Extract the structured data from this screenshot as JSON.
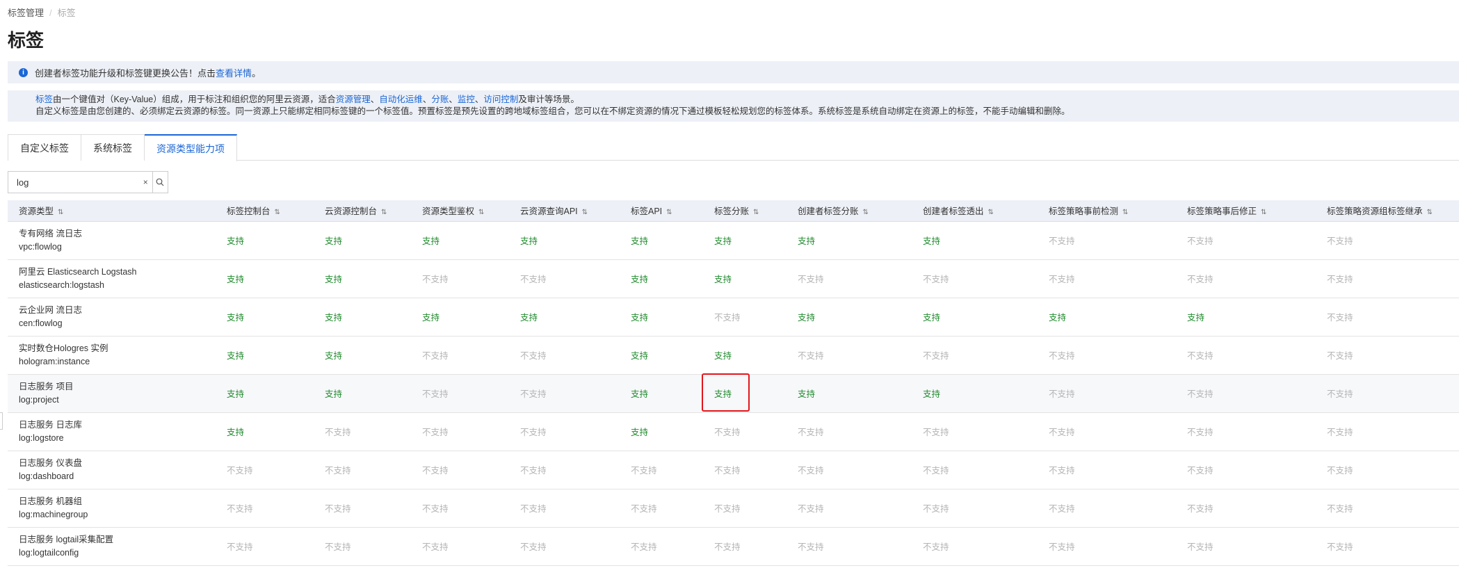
{
  "breadcrumb": [
    "标签管理",
    "标签"
  ],
  "page_title": "标签",
  "notice": {
    "text": "创建者标签功能升级和标签键更换公告！点击",
    "link": "查看详情",
    "suffix": "。"
  },
  "info": {
    "line1": [
      {
        "t": "标签",
        "link": true
      },
      {
        "t": "由一个键值对（Key-Value）组成，用于标注和组织您的阿里云资源，适合",
        "link": false
      },
      {
        "t": "资源管理",
        "link": true
      },
      {
        "t": "、",
        "link": false
      },
      {
        "t": "自动化运维",
        "link": true
      },
      {
        "t": "、",
        "link": false
      },
      {
        "t": "分账",
        "link": true
      },
      {
        "t": "、",
        "link": false
      },
      {
        "t": "监控",
        "link": true
      },
      {
        "t": "、",
        "link": false
      },
      {
        "t": "访问控制",
        "link": true
      },
      {
        "t": "及审计等场景。",
        "link": false
      }
    ],
    "line2": "自定义标签是由您创建的、必须绑定云资源的标签。同一资源上只能绑定相同标签键的一个标签值。预置标签是预先设置的跨地域标签组合，您可以在不绑定资源的情况下通过模板轻松规划您的标签体系。系统标签是系统自动绑定在资源上的标签，不能手动编辑和删除。"
  },
  "tabs": [
    {
      "label": "自定义标签",
      "active": false
    },
    {
      "label": "系统标签",
      "active": false
    },
    {
      "label": "资源类型能力项",
      "active": true
    }
  ],
  "search": {
    "value": "log",
    "clear_icon": "×",
    "search_icon": "search-icon"
  },
  "table": {
    "columns": [
      "资源类型",
      "标签控制台",
      "云资源控制台",
      "资源类型鉴权",
      "云资源查询API",
      "标签API",
      "标签分账",
      "创建者标签分账",
      "创建者标签透出",
      "标签策略事前检测",
      "标签策略事后修正",
      "标签策略资源组标签继承"
    ],
    "rows": [
      {
        "name": "专有网络 流日志",
        "code": "vpc:flowlog",
        "values": [
          "支持",
          "支持",
          "支持",
          "支持",
          "支持",
          "支持",
          "支持",
          "支持",
          "不支持",
          "不支持",
          "不支持"
        ]
      },
      {
        "name": "阿里云 Elasticsearch Logstash",
        "code": "elasticsearch:logstash",
        "values": [
          "支持",
          "支持",
          "不支持",
          "不支持",
          "支持",
          "支持",
          "不支持",
          "不支持",
          "不支持",
          "不支持",
          "不支持"
        ]
      },
      {
        "name": "云企业网 流日志",
        "code": "cen:flowlog",
        "values": [
          "支持",
          "支持",
          "支持",
          "支持",
          "支持",
          "不支持",
          "支持",
          "支持",
          "支持",
          "支持",
          "不支持"
        ]
      },
      {
        "name": "实时数仓Hologres 实例",
        "code": "hologram:instance",
        "values": [
          "支持",
          "支持",
          "不支持",
          "不支持",
          "支持",
          "支持",
          "不支持",
          "不支持",
          "不支持",
          "不支持",
          "不支持"
        ]
      },
      {
        "name": "日志服务 项目",
        "code": "log:project",
        "values": [
          "支持",
          "支持",
          "不支持",
          "不支持",
          "支持",
          "支持",
          "支持",
          "支持",
          "不支持",
          "不支持",
          "不支持"
        ]
      },
      {
        "name": "日志服务 日志库",
        "code": "log:logstore",
        "values": [
          "支持",
          "不支持",
          "不支持",
          "不支持",
          "支持",
          "不支持",
          "不支持",
          "不支持",
          "不支持",
          "不支持",
          "不支持"
        ]
      },
      {
        "name": "日志服务 仪表盘",
        "code": "log:dashboard",
        "values": [
          "不支持",
          "不支持",
          "不支持",
          "不支持",
          "不支持",
          "不支持",
          "不支持",
          "不支持",
          "不支持",
          "不支持",
          "不支持"
        ]
      },
      {
        "name": "日志服务 机器组",
        "code": "log:machinegroup",
        "values": [
          "不支持",
          "不支持",
          "不支持",
          "不支持",
          "不支持",
          "不支持",
          "不支持",
          "不支持",
          "不支持",
          "不支持",
          "不支持"
        ]
      },
      {
        "name": "日志服务 logtail采集配置",
        "code": "log:logtailconfig",
        "values": [
          "不支持",
          "不支持",
          "不支持",
          "不支持",
          "不支持",
          "不支持",
          "不支持",
          "不支持",
          "不支持",
          "不支持",
          "不支持"
        ]
      }
    ]
  },
  "colors": {
    "accent": "#1a66d6",
    "supported": "#1f8a2c",
    "unsupported": "#b5b5b5",
    "highlight": "#e4151b"
  }
}
